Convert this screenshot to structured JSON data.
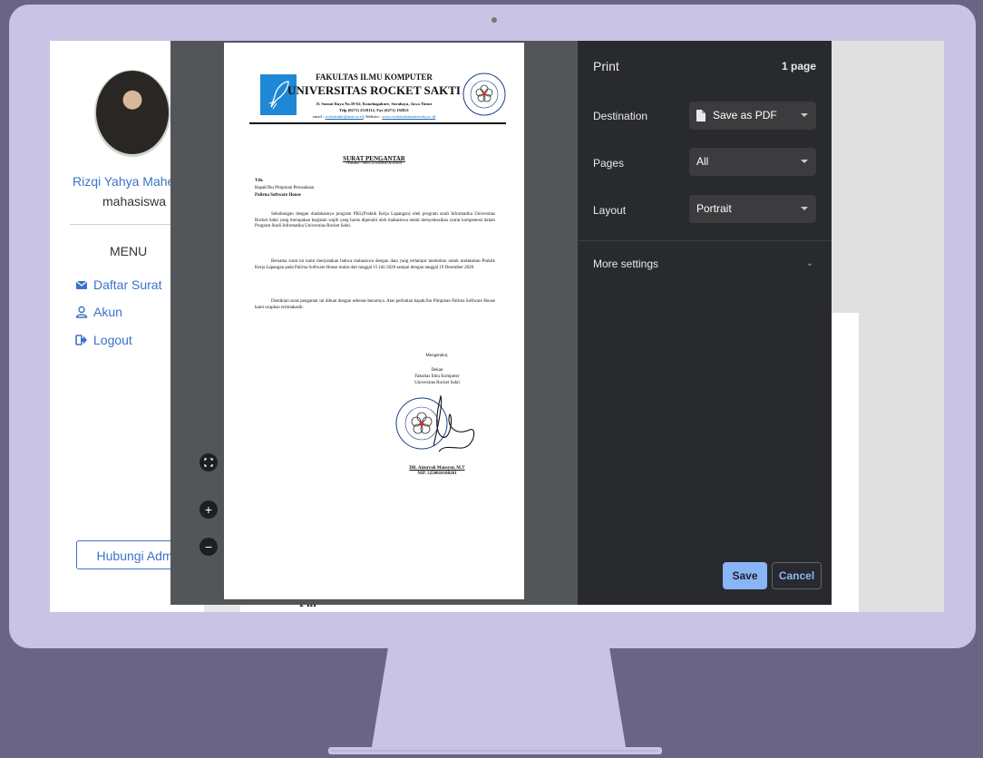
{
  "sidebar": {
    "user_name": "Rizqi Yahya Mahendra",
    "role": "mahasiswa",
    "menu_heading": "MENU",
    "items": [
      {
        "label": "Daftar Surat",
        "icon": "envelope-icon"
      },
      {
        "label": "Akun",
        "icon": "user-icon"
      },
      {
        "label": "Logout",
        "icon": "logout-icon"
      }
    ],
    "contact_button": "Hubungi Admin"
  },
  "background": {
    "partial_text": "Pin"
  },
  "document": {
    "faculty": "FAKULTAS ILMU KOMPUTER",
    "university": "UNIVERSITAS ROCKET SAKTI",
    "address": "Jl. Sunsui Raya No.59-62, Konohagakure, Surabaya, Jawa Timur",
    "phone": "Telp (0271) 2318112, Fax (0271) 192821",
    "email_prefix": "email : ",
    "email": "rocketsakti@univ.ac.id",
    "website_prefix": ", Website : ",
    "website": "www.rocketsaktiuniversity.ac.id",
    "letter_title": "SURAT PENGANTAR",
    "letter_number": "Nomor : MG.3/3/EKS/X/2020",
    "recipient_label": "Yth.",
    "recipient_line1": "Bapak/Ibu Pimpinan Perusahaan",
    "recipient_line2": "Palirna Software House",
    "paragraph1": "Sehubungan dengan diadakannya program PKL(Praktik Kerja Lapangan) oleh program studi Informatika Universitas Rocket Sakti yang merupakan kegiatan wajib yang harus dipenuhi oleh mahasiswa untuk menyelesaikan syarat kompetensi dalam Program Studi Infromatika Universtias Rocket Sakti.",
    "paragraph2": "Bersama surat ini kami menyatakan bahwa mahasiswa dengan data yang terlampir memohon untuk melakukan Praktik Kerja Lapangan pada Palirna Software House mulai dari tanggal 15 Juli 2020 sampai dengan tanggal 19 Desember 2020.",
    "paragraph3": "Demikian surat pengantar ini dibuat dengan sebenar-benarnya. Atas perhatian bapak/ibu Pimpinan Palirna Software House kami ucapkan terimakasih.",
    "sign_known": "Mengetahui,",
    "sign_position": "Dekan",
    "sign_faculty": "Fakultas Ilmu Komputer",
    "sign_university": "Universitas Rocket Sakti",
    "sign_name": "DR. Aizurrah Mansyur, M.T",
    "sign_nip": "NIP. 3250818108201",
    "seal_text_top": "ULUDAG UNIVERSITESI",
    "seal_text_bottom": "TIP FAKULTESI"
  },
  "print": {
    "title": "Print",
    "page_count": "1 page",
    "destination_label": "Destination",
    "destination_value": "Save as PDF",
    "pages_label": "Pages",
    "pages_value": "All",
    "layout_label": "Layout",
    "layout_value": "Portrait",
    "more_settings": "More settings",
    "save": "Save",
    "cancel": "Cancel"
  },
  "zoom": {
    "fit": "⛶",
    "zoom_in": "+",
    "zoom_out": "−"
  },
  "colors": {
    "link": "#3b73c9",
    "print_panel": "#292a2d",
    "save_button": "#8ab4f8",
    "monitor_frame": "#c9c3e6",
    "desk": "#6b6585"
  }
}
